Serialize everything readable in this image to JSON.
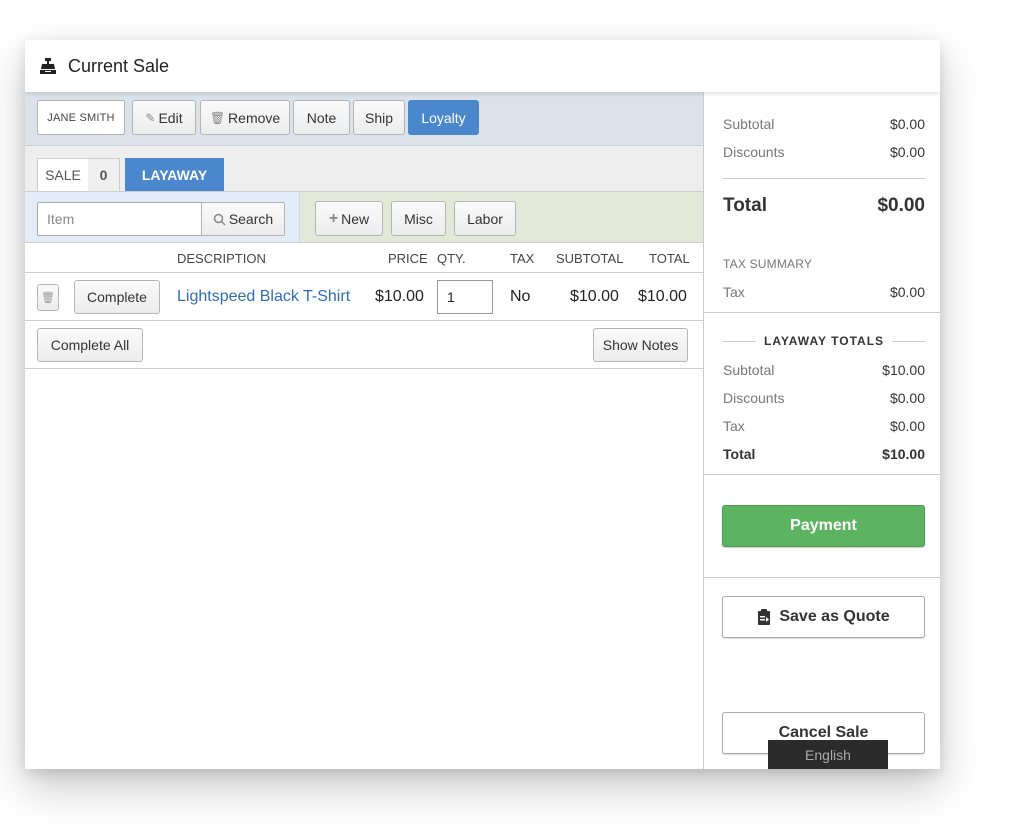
{
  "window": {
    "title": "Current Sale",
    "title_icon": "cash-register-icon"
  },
  "customer_bar": {
    "customer_name": "JANE SMITH",
    "buttons": [
      {
        "label": "Edit",
        "icon": "pencil-icon"
      },
      {
        "label": "Remove",
        "icon": "trash-icon"
      },
      {
        "label": "Note"
      },
      {
        "label": "Ship"
      },
      {
        "label": "Loyalty",
        "active": true
      }
    ]
  },
  "tabs": {
    "sale_label": "SALE",
    "sale_count": "0",
    "layaway_label": "LAYAWAY"
  },
  "search": {
    "placeholder": "Item",
    "value": "",
    "button_label": "Search"
  },
  "add_buttons": {
    "new_label": "New",
    "misc_label": "Misc",
    "labor_label": "Labor"
  },
  "table": {
    "columns": [
      "DESCRIPTION",
      "PRICE",
      "QTY.",
      "TAX",
      "SUBTOTAL",
      "TOTAL"
    ],
    "rows": [
      {
        "complete_label": "Complete",
        "description": "Lightspeed Black T-Shirt",
        "price": "$10.00",
        "qty": "1",
        "tax": "No",
        "subtotal": "$10.00",
        "total": "$10.00"
      }
    ],
    "complete_all_label": "Complete All",
    "show_notes_label": "Show Notes"
  },
  "summary": {
    "subtotal_label": "Subtotal",
    "subtotal": "$0.00",
    "discounts_label": "Discounts",
    "discounts": "$0.00",
    "total_label": "Total",
    "total": "$0.00",
    "tax_summary_label": "TAX SUMMARY",
    "tax_label": "Tax",
    "tax": "$0.00"
  },
  "layaway_totals": {
    "title": "LAYAWAY TOTALS",
    "subtotal_label": "Subtotal",
    "subtotal": "$10.00",
    "discounts_label": "Discounts",
    "discounts": "$0.00",
    "tax_label": "Tax",
    "tax": "$0.00",
    "total_label": "Total",
    "total": "$10.00"
  },
  "actions": {
    "payment_label": "Payment",
    "save_quote_label": "Save as Quote",
    "cancel_sale_label": "Cancel Sale"
  },
  "language": "English",
  "colors": {
    "accent_blue": "#4a87cc",
    "payment_green": "#5cb461",
    "link_blue": "#2f6db5"
  }
}
